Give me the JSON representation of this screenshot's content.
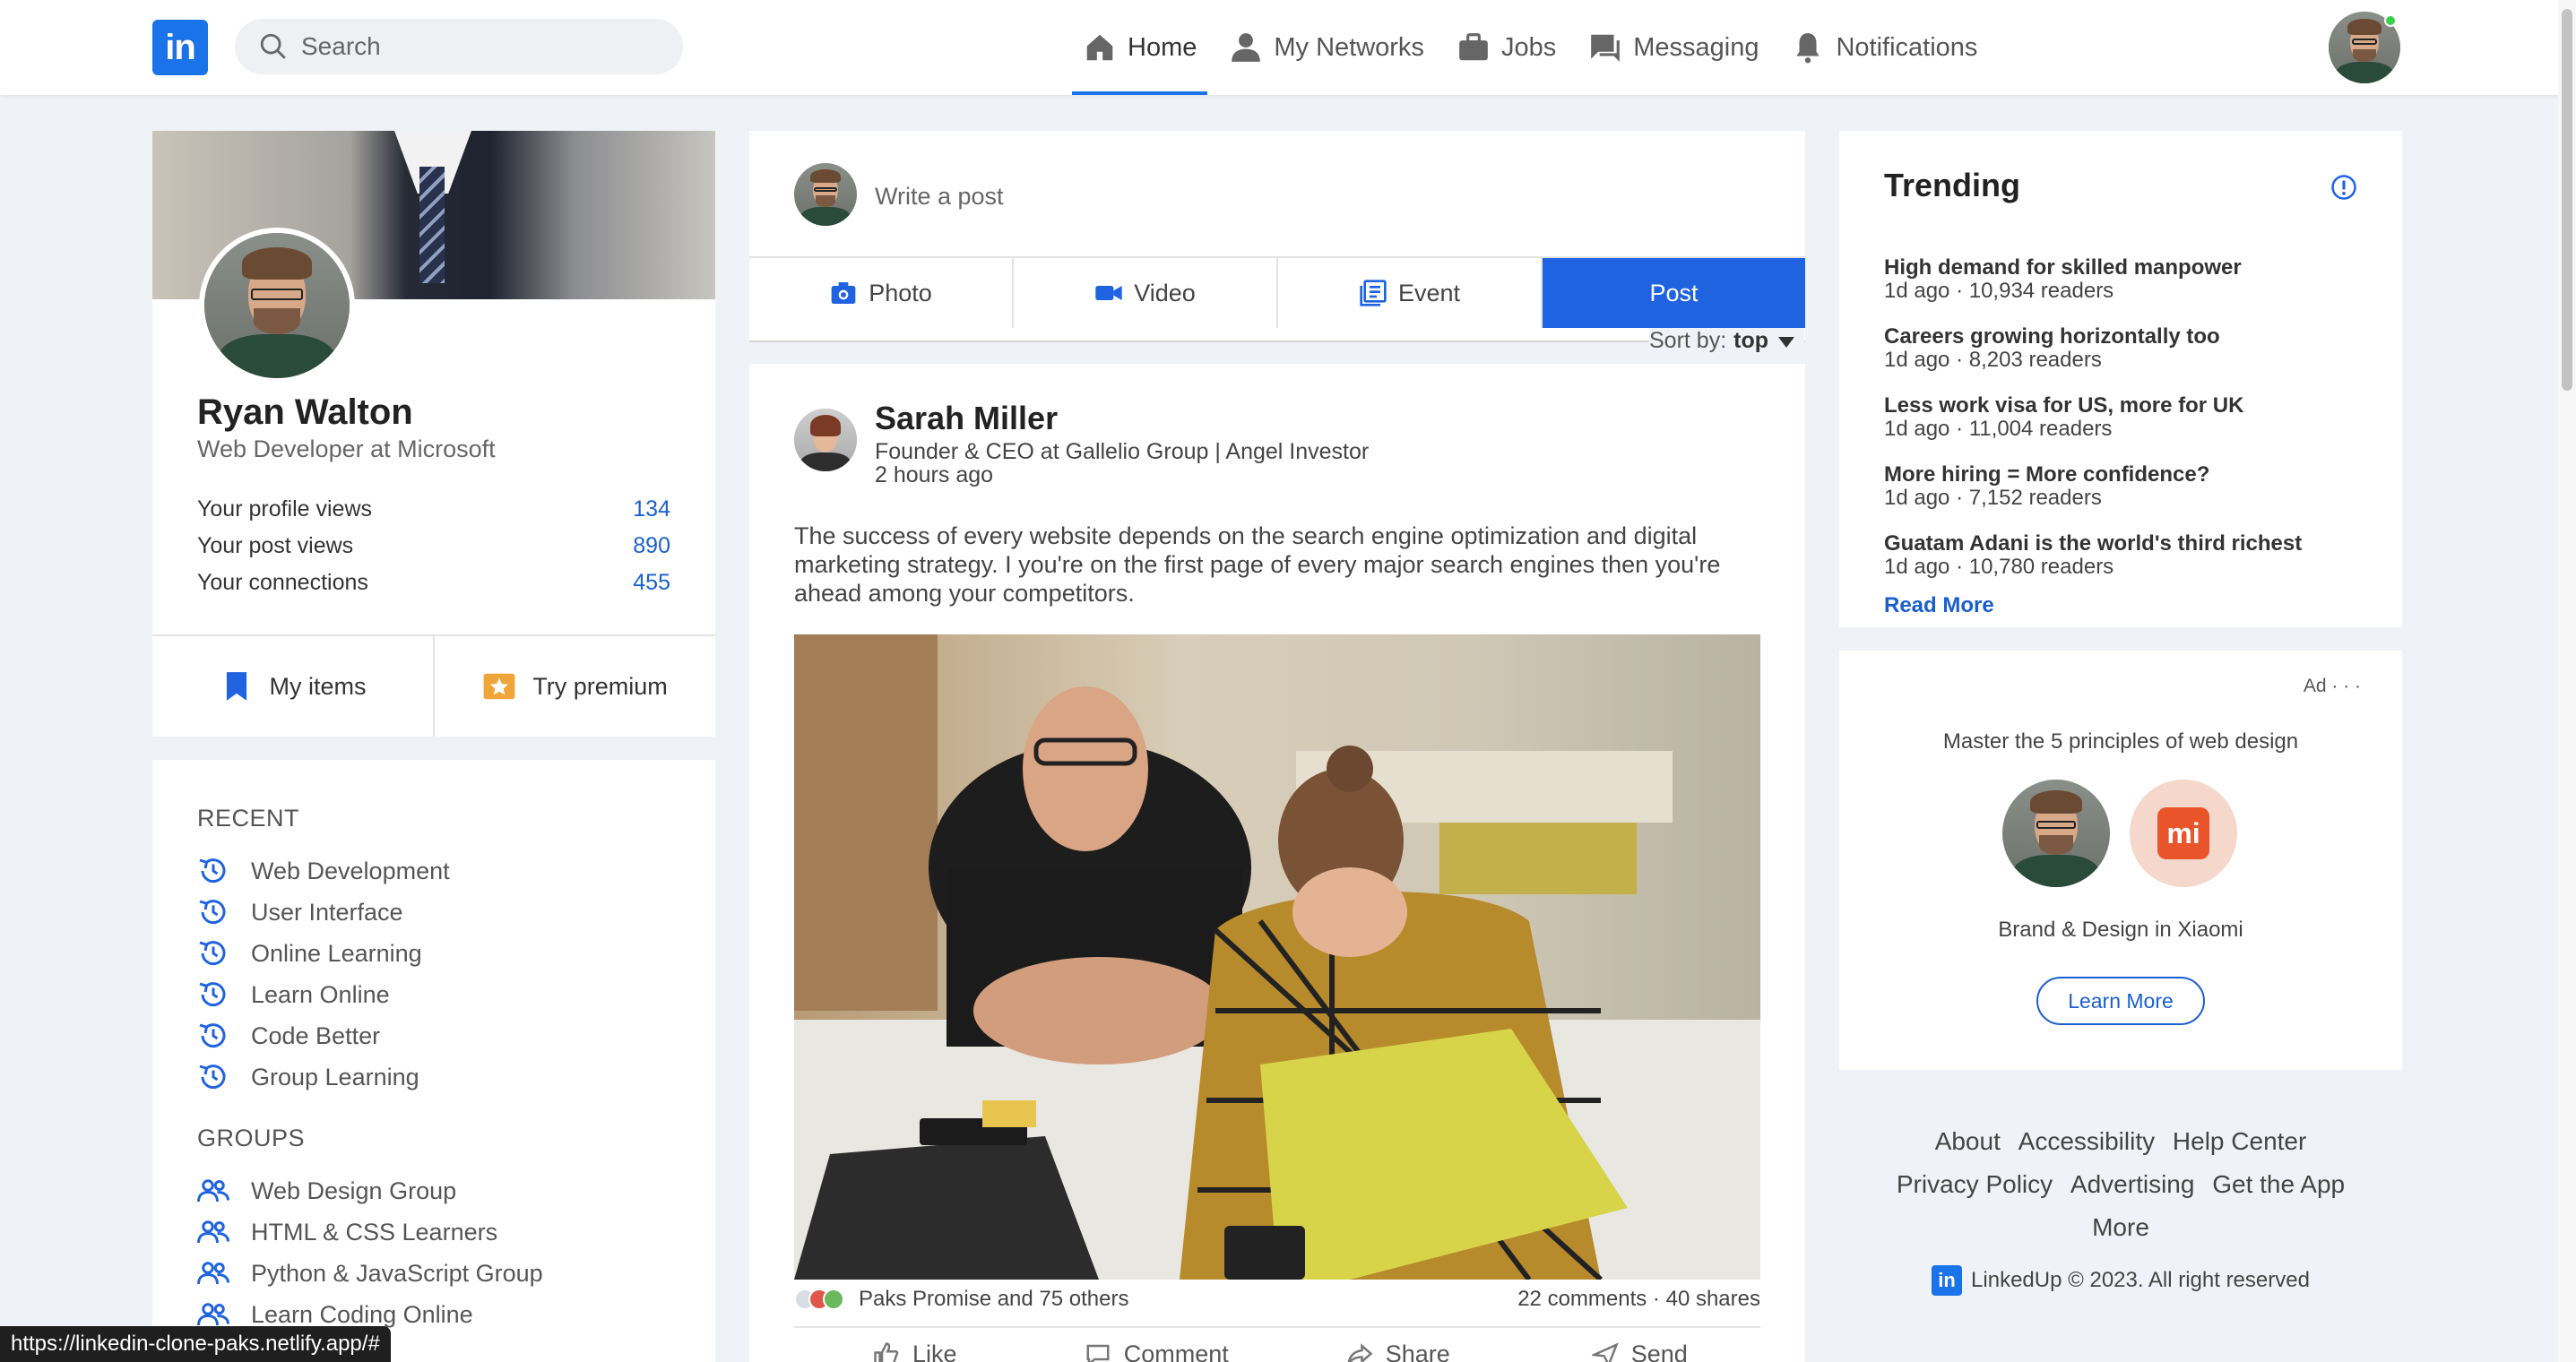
{
  "navbar": {
    "logo": "in",
    "search_placeholder": "Search",
    "items": [
      {
        "label": "Home",
        "icon": "home-icon",
        "active": true
      },
      {
        "label": "My Networks",
        "icon": "person-icon",
        "active": false
      },
      {
        "label": "Jobs",
        "icon": "briefcase-icon",
        "active": false
      },
      {
        "label": "Messaging",
        "icon": "chat-icon",
        "active": false
      },
      {
        "label": "Notifications",
        "icon": "bell-icon",
        "active": false
      }
    ]
  },
  "profile": {
    "name": "Ryan Walton",
    "title": "Web Developer at Microsoft",
    "stats": [
      {
        "label": "Your profile views",
        "value": "134"
      },
      {
        "label": "Your post views",
        "value": "890"
      },
      {
        "label": "Your connections",
        "value": "455"
      }
    ],
    "actions": [
      {
        "label": "My items",
        "icon": "bookmark-icon"
      },
      {
        "label": "Try premium",
        "icon": "premium-star-icon"
      }
    ]
  },
  "sidebar": {
    "recent_heading": "RECENT",
    "recent": [
      "Web Development",
      "User Interface",
      "Online Learning",
      "Learn Online",
      "Code Better",
      "Group Learning"
    ],
    "groups_heading": "GROUPS",
    "groups": [
      "Web Design Group",
      "HTML & CSS Learners",
      "Python & JavaScript Group",
      "Learn Coding Online"
    ]
  },
  "composer": {
    "placeholder": "Write a post",
    "buttons": [
      {
        "label": "Photo",
        "icon": "camera-icon"
      },
      {
        "label": "Video",
        "icon": "video-icon"
      },
      {
        "label": "Event",
        "icon": "event-icon"
      },
      {
        "label": "Post",
        "icon": ""
      }
    ],
    "sort_label": "Sort by:",
    "sort_value": "top"
  },
  "post": {
    "author": "Sarah Miller",
    "role": "Founder & CEO at Gallelio Group | Angel Investor",
    "time": "2 hours ago",
    "body": "The success of every website depends on the search engine optimization and digital marketing strategy. I you're on the first page of every major search engines then you're ahead among your competitors.",
    "reactions_label": "Paks Promise and 75 others",
    "counts": "22 comments · 40 shares",
    "actions": [
      "Like",
      "Comment",
      "Share",
      "Send"
    ]
  },
  "trending": {
    "title": "Trending",
    "items": [
      {
        "title": "High demand for skilled manpower",
        "meta": "1d ago · 10,934 readers"
      },
      {
        "title": "Careers growing horizontally too",
        "meta": "1d ago · 8,203 readers"
      },
      {
        "title": "Less work visa for US, more for UK",
        "meta": "1d ago · 11,004 readers"
      },
      {
        "title": "More hiring = More confidence?",
        "meta": "1d ago · 7,152 readers"
      },
      {
        "title": "Guatam Adani is the world's third richest",
        "meta": "1d ago · 10,780 readers"
      }
    ],
    "read_more": "Read More"
  },
  "ad": {
    "label": "Ad · · ·",
    "text": "Master the 5 principles of web design",
    "brand_glyph": "mi",
    "subtext": "Brand & Design in Xiaomi",
    "button": "Learn More"
  },
  "footer": {
    "row1": [
      "About",
      "Accessibility",
      "Help Center"
    ],
    "row2": [
      "Privacy Policy",
      "Advertising",
      "Get the App"
    ],
    "row3": [
      "More"
    ],
    "logo": "in",
    "copyright": "LinkedUp © 2023. All right reserved"
  },
  "status_url": "https://linkedin-clone-paks.netlify.app/#",
  "colors": {
    "accent": "#1a73e8",
    "primary_button": "#1f63e0",
    "link": "#1a5fd0"
  }
}
